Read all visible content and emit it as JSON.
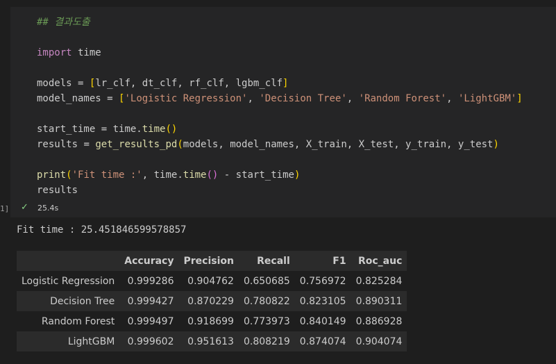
{
  "cell": {
    "gutter_label": "1]",
    "lines": [
      [
        {
          "c": "comment",
          "t": "## 결과도출"
        }
      ],
      [],
      [
        {
          "c": "kw",
          "t": "import"
        },
        {
          "c": "var",
          "t": " time"
        }
      ],
      [],
      [
        {
          "c": "var",
          "t": "models "
        },
        {
          "c": "op",
          "t": "="
        },
        {
          "c": "var",
          "t": " "
        },
        {
          "c": "br1",
          "t": "["
        },
        {
          "c": "var",
          "t": "lr_clf, dt_clf, rf_clf, lgbm_clf"
        },
        {
          "c": "br1",
          "t": "]"
        }
      ],
      [
        {
          "c": "var",
          "t": "model_names "
        },
        {
          "c": "op",
          "t": "="
        },
        {
          "c": "var",
          "t": " "
        },
        {
          "c": "br1",
          "t": "["
        },
        {
          "c": "str",
          "t": "'Logistic Regression'"
        },
        {
          "c": "var",
          "t": ", "
        },
        {
          "c": "str",
          "t": "'Decision Tree'"
        },
        {
          "c": "var",
          "t": ", "
        },
        {
          "c": "str",
          "t": "'Random Forest'"
        },
        {
          "c": "var",
          "t": ", "
        },
        {
          "c": "str",
          "t": "'LightGBM'"
        },
        {
          "c": "br1",
          "t": "]"
        }
      ],
      [],
      [
        {
          "c": "var",
          "t": "start_time "
        },
        {
          "c": "op",
          "t": "="
        },
        {
          "c": "var",
          "t": " time."
        },
        {
          "c": "fn",
          "t": "time"
        },
        {
          "c": "br1",
          "t": "()"
        }
      ],
      [
        {
          "c": "var",
          "t": "results "
        },
        {
          "c": "op",
          "t": "="
        },
        {
          "c": "var",
          "t": " "
        },
        {
          "c": "fn",
          "t": "get_results_pd"
        },
        {
          "c": "br1",
          "t": "("
        },
        {
          "c": "var",
          "t": "models, model_names, X_train, X_test, y_train, y_test"
        },
        {
          "c": "br1",
          "t": ")"
        }
      ],
      [],
      [
        {
          "c": "fn",
          "t": "print"
        },
        {
          "c": "br1",
          "t": "("
        },
        {
          "c": "str",
          "t": "'Fit time :'"
        },
        {
          "c": "var",
          "t": ", time."
        },
        {
          "c": "fn",
          "t": "time"
        },
        {
          "c": "br2",
          "t": "()"
        },
        {
          "c": "var",
          "t": " "
        },
        {
          "c": "op",
          "t": "-"
        },
        {
          "c": "var",
          "t": " start_time"
        },
        {
          "c": "br1",
          "t": ")"
        }
      ],
      [
        {
          "c": "var",
          "t": "results"
        }
      ]
    ],
    "exec_time": "25.4s"
  },
  "output": {
    "fit_text": "Fit time : 25.451846599578857",
    "table": {
      "columns": [
        "",
        "Accuracy",
        "Precision",
        "Recall",
        "F1",
        "Roc_auc"
      ],
      "rows": [
        [
          "Logistic Regression",
          "0.999286",
          "0.904762",
          "0.650685",
          "0.756972",
          "0.825284"
        ],
        [
          "Decision Tree",
          "0.999427",
          "0.870229",
          "0.780822",
          "0.823105",
          "0.890311"
        ],
        [
          "Random Forest",
          "0.999497",
          "0.918699",
          "0.773973",
          "0.840149",
          "0.886928"
        ],
        [
          "LightGBM",
          "0.999602",
          "0.951613",
          "0.808219",
          "0.874074",
          "0.904074"
        ]
      ]
    }
  }
}
